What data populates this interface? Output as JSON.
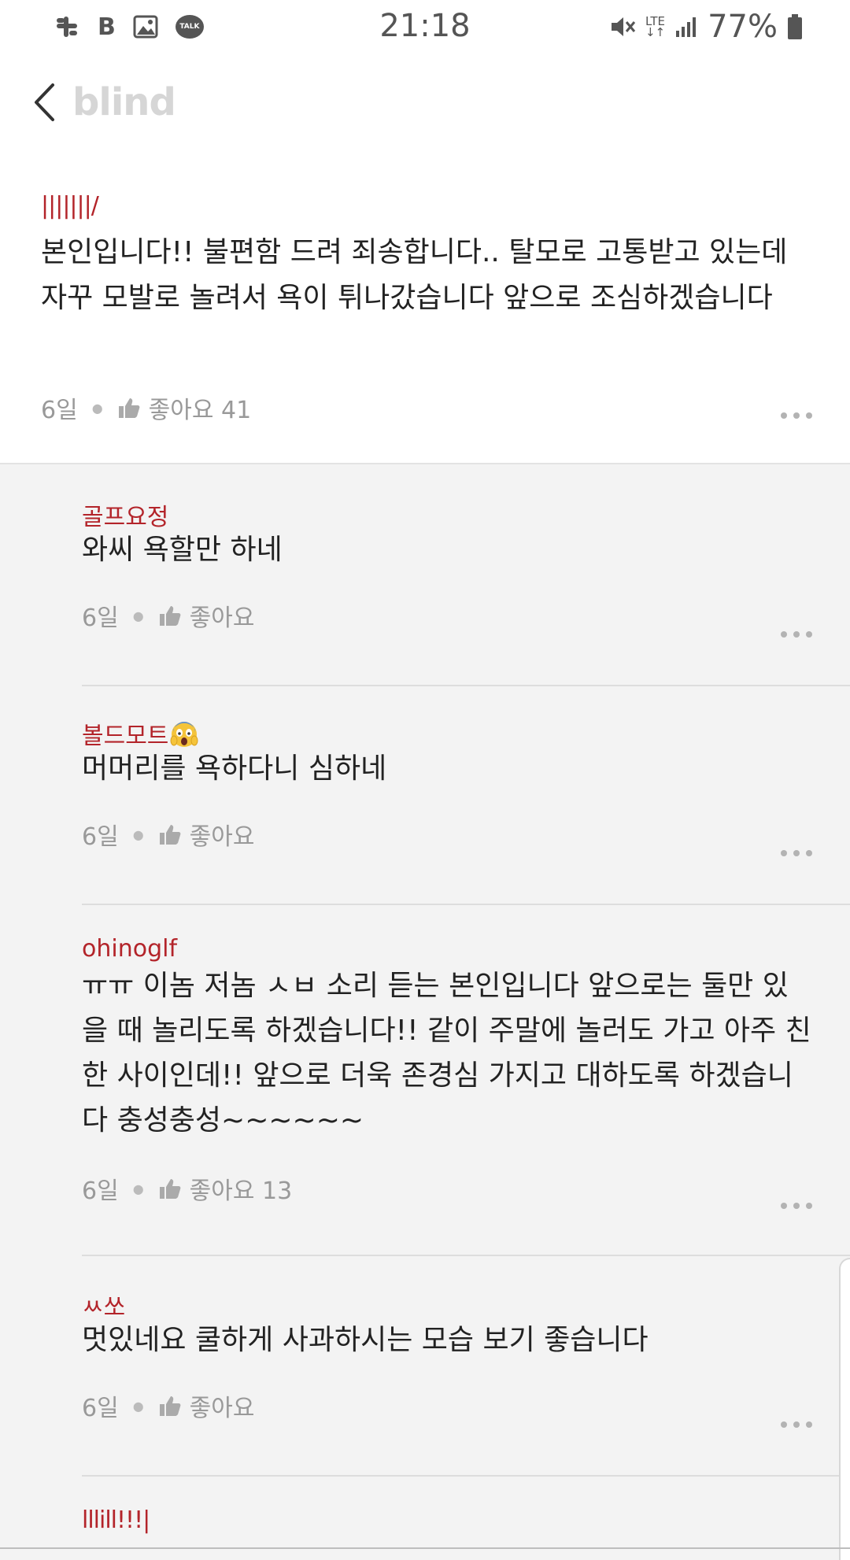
{
  "status_bar": {
    "time": "21:18",
    "battery": "77%",
    "network": "LTE",
    "left_icons": [
      "slack-icon",
      "b-icon",
      "image-icon",
      "talk-icon"
    ],
    "talk_label": "TALK",
    "b_label": "B"
  },
  "header": {
    "logo": "blind"
  },
  "main_comment": {
    "author": "|||||||/",
    "text": "본인입니다!! 불편함 드려 죄송합니다.. 탈모로 고통받고 있는데 자꾸 모발로 놀려서 욕이 튀나갔습니다 앞으로 조심하겠습니다",
    "age": "6일",
    "likes": "좋아요 41"
  },
  "replies": [
    {
      "author": "골프요정",
      "text": "와씨 욕할만 하네",
      "age": "6일",
      "likes": "좋아요"
    },
    {
      "author": "볼드모트",
      "author_emoji": "😱",
      "text": "머머리를 욕하다니 심하네",
      "age": "6일",
      "likes": "좋아요"
    },
    {
      "author": "ohinoglf",
      "text": "ㅠㅠ 이놈 저놈 ㅅㅂ 소리 듣는 본인입니다 앞으로는 둘만 있을 때 놀리도록 하겠습니다!! 같이 주말에 놀러도 가고 아주 친한 사이인데!! 앞으로 더욱 존경심 가지고 대하도록 하겠습니다 충성충성~~~~~~",
      "age": "6일",
      "likes": "좋아요 13"
    },
    {
      "author": "ㅆ쏘",
      "text": "멋있네요 쿨하게 사과하시는 모습 보기 좋습니다",
      "age": "6일",
      "likes": "좋아요"
    },
    {
      "author": "lllill!!!|"
    }
  ],
  "colors": {
    "author": "#b3242a",
    "meta": "#999999",
    "reply_bg": "#f3f3f3"
  }
}
